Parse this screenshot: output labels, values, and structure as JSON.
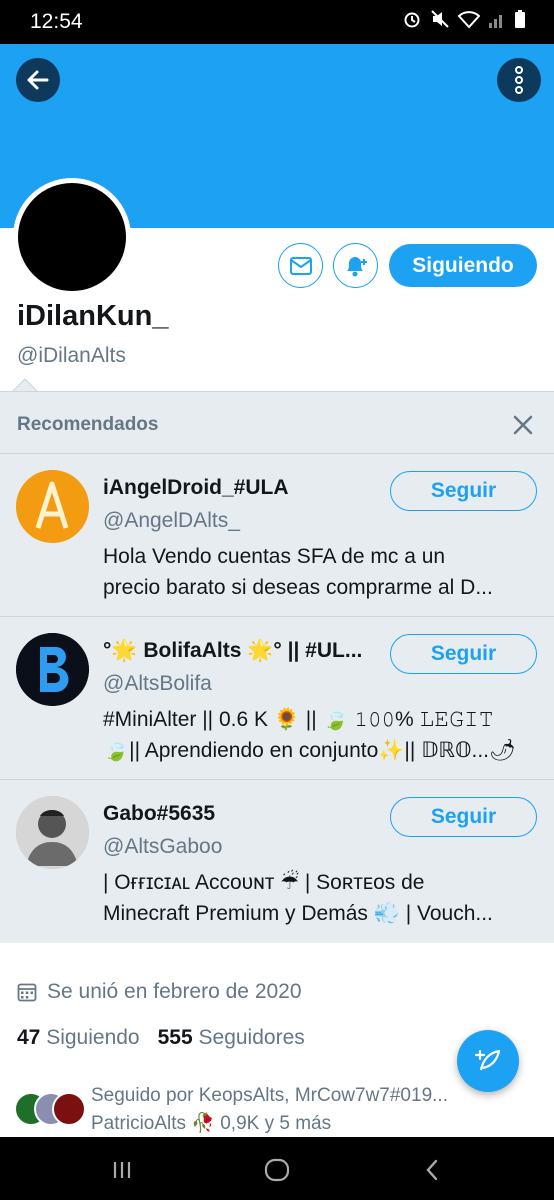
{
  "status_bar": {
    "time": "12:54"
  },
  "profile": {
    "display_name": "iDilanKun_",
    "handle": "@iDilanAlts",
    "following_button": "Siguiendo"
  },
  "recommended": {
    "title": "Recomendados",
    "accounts": [
      {
        "name": "iAngelDroid_#ULA",
        "handle": "@AngelDAlts_",
        "bio_line1": "Hola Vendo cuentas  SFA de mc a un",
        "bio_line2": "precio barato si deseas comprarme al D...",
        "button": "Seguir"
      },
      {
        "name": "°🌟 BolifaAlts 🌟° || #UL...",
        "handle": "@AltsBolifa",
        "bio_line1": "#MiniAlter || 0.6 K 🌻 || 🍃 𝟷𝟶𝟶% 𝙻𝙴𝙶𝙸𝚃",
        "bio_line2": "🍃|| Aprendiendo en conjunto✨|| 𝔻ℝ𝕆...🌶",
        "button": "Seguir"
      },
      {
        "name": "Gabo#5635",
        "handle": "@AltsGaboo",
        "bio_line1": "| Oғғɪᴄɪᴀʟ Aᴄᴄᴏᴜɴᴛ ☔ | Sᴏʀᴛᴇᴏs de",
        "bio_line2": "Minecraft Premium y Demás 💨 | Vouch...",
        "button": "Seguir"
      }
    ]
  },
  "joined": "Se unió en febrero de 2020",
  "stats": {
    "following_count": "47",
    "following_label": "Siguiendo",
    "followers_count": "555",
    "followers_label": "Seguidores"
  },
  "followed_by": {
    "line1": "Seguido por KeopsAlts, MrCow7w7#019...",
    "line2": "PatricioAlts 🥀 0,9K y 5 más"
  },
  "colors": {
    "accent": "#1da1f2",
    "banner": "#1da1f2",
    "secondary_text": "#657786",
    "recommended_bg": "#e6ecf0"
  },
  "icons": {
    "back": "arrow-left-icon",
    "more": "more-vertical-icon",
    "mail": "envelope-icon",
    "notify": "bell-plus-icon",
    "close": "close-icon",
    "calendar": "calendar-icon",
    "compose": "compose-tweet-icon"
  }
}
